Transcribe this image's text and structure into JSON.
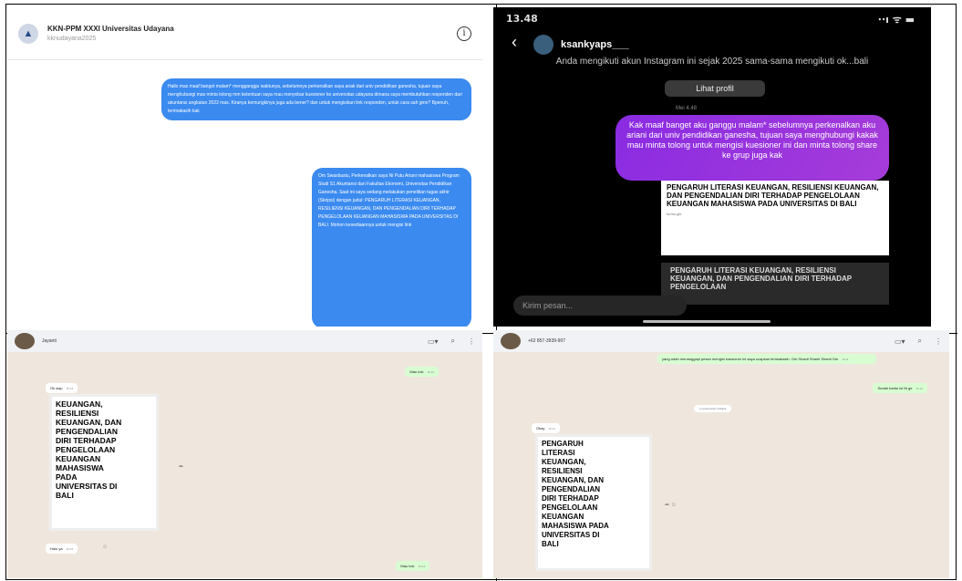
{
  "panel1": {
    "title": "KKN-PPM XXXI Universitas Udayana",
    "subtitle": "kknudayana2025",
    "info_icon": "info-icon",
    "message1": "Hallo mas maaf banget malam* mengganggu waktunya, sebelumnya perkenalkan saya anak dari univ pendidikan ganesha, tujuan saya menghubungi mas minta tolong mm ketentuan saya mau menyebar kuesioner ke universitas udayana dimana saya membutuhkan responden dari akuntansi angkatan 2022 mas. Kiranya kemungkinya juga ada bener? dan untuk mengisikan link responden, untuk cara sah gmn? Bpenuh, terimakasih kak",
    "message2": "Om Swastiastu, Perkenalkan saya Ni Putu Ariani mahasiswa Program Studi S1 Akuntansi dari Fakultas Ekonomi, Universitas Pendidikan Ganesha. Saat ini saya sedang melakukan penelitian tugas akhir (Skripsi) dengan judul: PENGARUH LITERASI KEUANGAN, RESILIENSI KEUANGAN, DAN PENGENDALIAN DIRI TERHADAP PENGELOLAAN KEUANGAN MAHASISWA PADA UNIVERSITAS DI BALI. Mohon kesediaannya untuk mengisi link"
  },
  "panel2": {
    "time": "13.48",
    "status_icons": "⋅⋅ı ᯤ ▬",
    "back": "‹",
    "username": "ksankyaps___",
    "follow_info": "Anda mengikuti akun Instagram ini sejak 2025 sama-sama mengikuti ok...bali",
    "profile_button": "Lihat profil",
    "timestamp": "Mei 4.48",
    "message": "Kak maaf banget aku ganggu malam* sebelumnya perkenalkan aku ariani dari univ pendidikan ganesha, tujuan saya menghubungi kakak mau minta tolong untuk mengisi kuesioner ini dan minta tolong share ke grup juga kak",
    "doc_title": "PENGARUH LITERASI KEUANGAN, RESILIENSI KEUANGAN, DAN PENGENDALIAN DIRI TERHADAP PENGELOLAAN KEUANGAN MAHASISWA PADA UNIVERSITAS DI BALI",
    "doc_sub": "forms.gle",
    "doc2_title": "PENGARUH LITERASI KEUANGAN, RESILIENSI KEUANGAN, DAN PENGENDALIAN DIRI TERHADAP PENGELOLAAN",
    "input_placeholder": "Kirim pesan..."
  },
  "panel3": {
    "contact": "Jayanti",
    "msg_out1": "Mau tolc",
    "time_out1": "16.12",
    "msg_in1": "Ok siap",
    "time_in1": "16.13",
    "doc_lines": [
      "KEUANGAN,",
      "RESILIENSI",
      "KEUANGAN, DAN",
      "PENGENDALIAN",
      "DIRI TERHADAP",
      "PENGELOLAAN",
      "KEUANGAN",
      "MAHASISWA",
      "PADA",
      "UNIVERSITAS DI",
      "BALI"
    ],
    "msg_in2": "Halo ya",
    "time_in2": "16.13",
    "msg_out2": "Mau tolc",
    "time_out2": "16.14"
  },
  "panel4": {
    "contact": "+62 857-3939-907",
    "msg_out1": "yang udah menanggapi pesan mengisi kuesioner ini saya ucapkan terimakasih. Om Shanti Shanti Shanti Om",
    "time_out1": "16.11",
    "msg_out2": "Sudah bantu isi Ni ge",
    "time_out2": "16.12",
    "chip": "1 pesan belum dibaca",
    "msg_in1": "Okay",
    "time_in1": "16.13",
    "doc_lines": [
      "PENGARUH",
      "LITERASI",
      "KEUANGAN,",
      "RESILIENSI",
      "KEUANGAN, DAN",
      "PENGENDALIAN",
      "DIRI TERHADAP",
      "PENGELOLAAN",
      "KEUANGAN",
      "MAHASISWA PADA",
      "UNIVERSITAS DI",
      "BALI"
    ]
  },
  "icons": {
    "video": "▭▾",
    "search": "⌕",
    "menu": "⋮"
  }
}
